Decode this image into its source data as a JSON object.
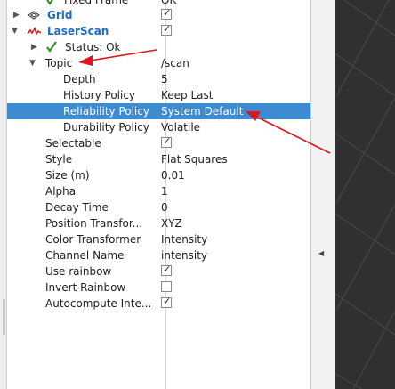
{
  "rows": [
    {
      "name": "Fixed Frame",
      "value": "OK"
    },
    {
      "name": "Grid",
      "value": ""
    },
    {
      "name": "LaserScan",
      "value": ""
    },
    {
      "name": "Status: Ok",
      "value": ""
    },
    {
      "name": "Topic",
      "value": "/scan"
    },
    {
      "name": "Depth",
      "value": "5"
    },
    {
      "name": "History Policy",
      "value": "Keep Last"
    },
    {
      "name": "Reliability Policy",
      "value": "System Default"
    },
    {
      "name": "Durability Policy",
      "value": "Volatile"
    },
    {
      "name": "Selectable",
      "value": ""
    },
    {
      "name": "Style",
      "value": "Flat Squares"
    },
    {
      "name": "Size (m)",
      "value": "0.01"
    },
    {
      "name": "Alpha",
      "value": "1"
    },
    {
      "name": "Decay Time",
      "value": "0"
    },
    {
      "name": "Position Transfor...",
      "value": "XYZ"
    },
    {
      "name": "Color Transformer",
      "value": "Intensity"
    },
    {
      "name": "Channel Name",
      "value": "intensity"
    },
    {
      "name": "Use rainbow",
      "value": ""
    },
    {
      "name": "Invert Rainbow",
      "value": ""
    },
    {
      "name": "Autocompute Inte...",
      "value": ""
    }
  ],
  "checkboxes": {
    "grid_enabled": true,
    "laserscan_enabled": true,
    "selectable": true,
    "use_rainbow": true,
    "invert_rainbow": false,
    "autocompute_intensity": true
  },
  "colors": {
    "selection": "#3d8bd0",
    "annotation_arrow": "#e0161a",
    "display_name": "#1d6dc4",
    "viewport_bg": "#303030"
  }
}
